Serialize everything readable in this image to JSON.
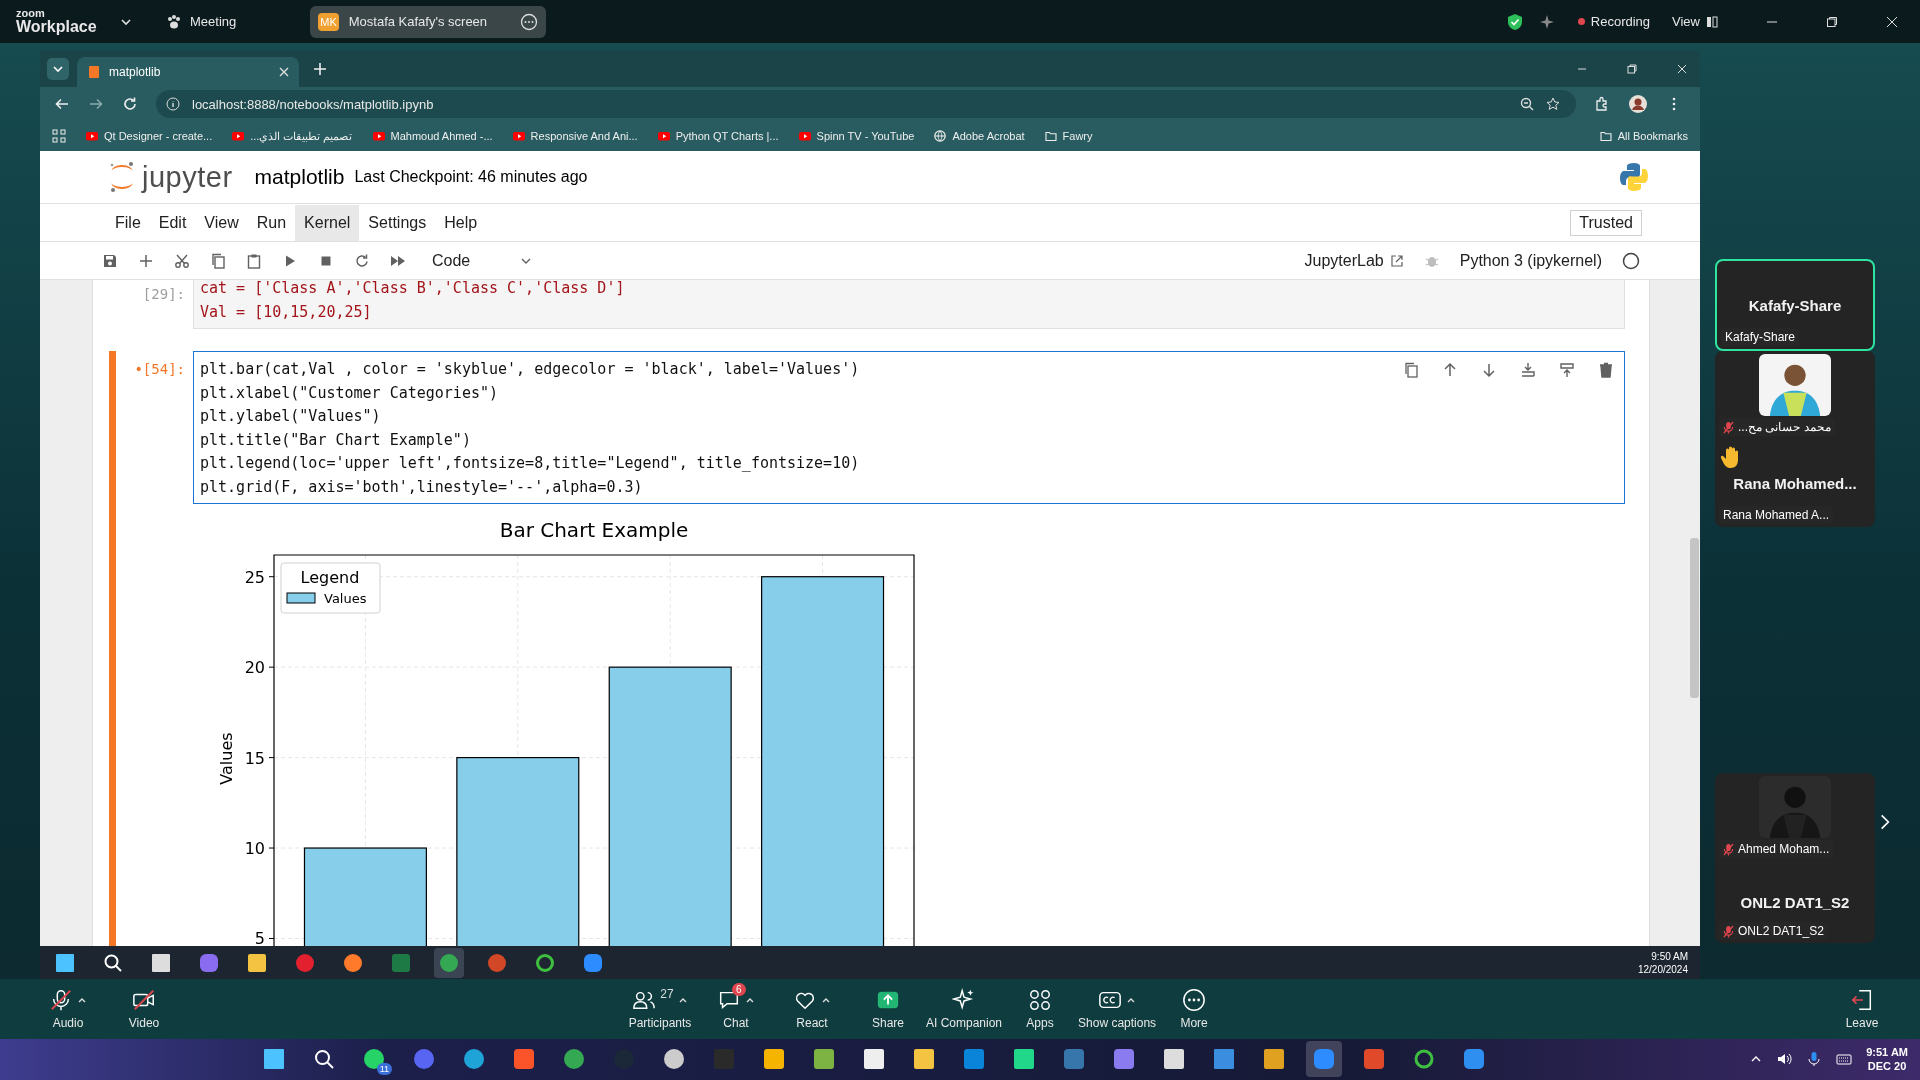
{
  "zoom_bar": {
    "brand_small": "zoom",
    "brand": "Workplace",
    "meeting": "Meeting",
    "share_pill": {
      "initials": "MK",
      "label": "Mostafa Kafafy's screen"
    },
    "recording": "Recording",
    "view": "View"
  },
  "browser": {
    "tabs": [
      {
        "title": "matplotlib",
        "selected": true
      }
    ],
    "url": "localhost:8888/notebooks/matplotlib.ipynb",
    "bookmarks": [
      {
        "label": "Qt Designer - create...",
        "kind": "video"
      },
      {
        "label": "تصميم تطبيقات الذي...",
        "kind": "video"
      },
      {
        "label": "Mahmoud Ahmed -...",
        "kind": "video"
      },
      {
        "label": "Responsive And Ani...",
        "kind": "video"
      },
      {
        "label": "Python QT Charts |...",
        "kind": "video"
      },
      {
        "label": "Spinn TV - YouTube",
        "kind": "video"
      },
      {
        "label": "Adobe Acrobat",
        "kind": "globe"
      },
      {
        "label": "Fawry",
        "kind": "folder"
      }
    ],
    "all_bookmarks": "All Bookmarks"
  },
  "jupyter": {
    "logo": "jupyter",
    "notebook": "matplotlib",
    "checkpoint": "Last Checkpoint: 46 minutes ago",
    "menu": [
      {
        "label": "File",
        "selected": false
      },
      {
        "label": "Edit",
        "selected": false
      },
      {
        "label": "View",
        "selected": false
      },
      {
        "label": "Run",
        "selected": false
      },
      {
        "label": "Kernel",
        "selected": true
      },
      {
        "label": "Settings",
        "selected": false
      },
      {
        "label": "Help",
        "selected": false
      }
    ],
    "trusted": "Trusted",
    "cell_type": "Code",
    "jupyterlab": "JupyterLab",
    "kernel": "Python 3 (ipykernel)",
    "cells": [
      {
        "prompt": "[29]:",
        "active": false,
        "lines": [
          "cat = ['Class A','Class B','Class C','Class D']",
          "Val = [10,15,20,25]"
        ]
      },
      {
        "prompt": "•[54]:",
        "active": true,
        "lines": [
          "plt.bar(cat,Val , color = 'skyblue', edgecolor = 'black', label='Values')",
          "plt.xlabel(\"Customer Categories\")",
          "plt.ylabel(\"Values\")",
          "plt.title(\"Bar Chart Example\")",
          "plt.legend(loc='upper left',fontsize=8,title=\"Legend\", title_fontsize=10)",
          "plt.grid(F, axis='both',linestyle='--',alpha=0.3)"
        ]
      }
    ],
    "output": {
      "legend_title": "Legend",
      "chart_data": {
        "type": "bar",
        "title": "Bar Chart Example",
        "ylabel": "Values",
        "series": [
          {
            "name": "Values",
            "color": "#87ceeb",
            "values": [
              10,
              15,
              20,
              25
            ]
          }
        ],
        "ylim": [
          3.7,
          26.2
        ],
        "yticks": [
          5,
          10,
          15,
          20,
          25
        ],
        "grid": true
      }
    }
  },
  "remote_taskbar": {
    "icons": [
      {
        "kind": "start"
      },
      {
        "kind": "search"
      },
      {
        "kind": "taskview"
      },
      {
        "kind": "copilot"
      },
      {
        "kind": "files"
      },
      {
        "kind": "opera"
      },
      {
        "kind": "firefox"
      },
      {
        "kind": "excel"
      },
      {
        "kind": "chrome",
        "selected": true
      },
      {
        "kind": "powerpoint"
      },
      {
        "kind": "ring"
      },
      {
        "kind": "zoom"
      }
    ],
    "time": "9:50 AM",
    "date": "12/20/2024"
  },
  "participants": [
    {
      "kind": "name",
      "title": "Kafafy-Share",
      "label": "Kafafy-Share",
      "active": true,
      "muted": false
    },
    {
      "label": "محمد حسانى مح...",
      "active": false,
      "muted": true
    },
    {
      "kind": "name",
      "title": "Rana  Mohamed...",
      "label": "Rana Mohamed A...",
      "active": false,
      "muted": false,
      "hand": true
    },
    {
      "label": "Ahmed Moham...",
      "active": false,
      "muted": true
    },
    {
      "kind": "name",
      "title": "ONL2 DAT1_S2",
      "label": "ONL2 DAT1_S2",
      "active": false,
      "muted": true
    }
  ],
  "zoom_toolbar": [
    {
      "kind": "audio",
      "label": "Audio",
      "off": true,
      "caret": true
    },
    {
      "kind": "video",
      "label": "Video",
      "off": true,
      "caret": false
    },
    {
      "kind": "participants",
      "label": "Participants",
      "count": "27",
      "caret": true
    },
    {
      "kind": "chat",
      "label": "Chat",
      "badge": "6",
      "caret": true
    },
    {
      "kind": "react",
      "label": "React",
      "caret": true
    },
    {
      "kind": "share",
      "label": "Share",
      "caret": false
    },
    {
      "kind": "ai",
      "label": "AI Companion",
      "caret": false
    },
    {
      "kind": "apps",
      "label": "Apps",
      "caret": false
    },
    {
      "kind": "captions",
      "label": "Show captions",
      "caret": true
    },
    {
      "kind": "more",
      "label": "More",
      "caret": false
    },
    {
      "kind": "leave",
      "label": "Leave",
      "caret": false
    }
  ],
  "local_taskbar": {
    "icons": [
      {
        "kind": "start"
      },
      {
        "kind": "search"
      },
      {
        "kind": "whatsapp",
        "badge": "11"
      },
      {
        "kind": "discord"
      },
      {
        "kind": "edge"
      },
      {
        "kind": "brave"
      },
      {
        "kind": "chrome"
      },
      {
        "kind": "steam"
      },
      {
        "kind": "obs"
      },
      {
        "kind": "epic"
      },
      {
        "kind": "rockstar"
      },
      {
        "kind": "chess"
      },
      {
        "kind": "mosque"
      },
      {
        "kind": "files"
      },
      {
        "kind": "vscode"
      },
      {
        "kind": "pycharm"
      },
      {
        "kind": "python"
      },
      {
        "kind": "qt"
      },
      {
        "kind": "plane"
      },
      {
        "kind": "window"
      },
      {
        "kind": "tools"
      },
      {
        "kind": "zoom",
        "selected": true
      },
      {
        "kind": "box"
      },
      {
        "kind": "ring"
      },
      {
        "kind": "sync"
      }
    ],
    "time": "9:51 AM",
    "date": "DEC 20"
  }
}
